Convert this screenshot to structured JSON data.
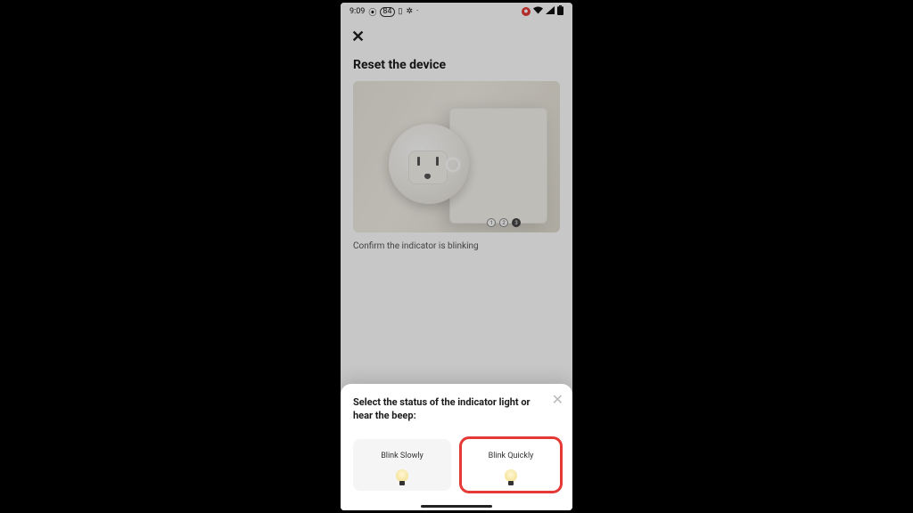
{
  "statusbar": {
    "time": "9:09",
    "batteryIcon": "84",
    "icons_left": [
      "camera",
      "vibrate",
      "bt"
    ],
    "icons_right": [
      "rec",
      "wifi",
      "signal",
      "battery"
    ]
  },
  "page": {
    "title": "Reset the device",
    "caption": "Confirm the indicator is blinking",
    "steps": {
      "total": 3,
      "current": 3
    }
  },
  "sheet": {
    "title": "Select the status of the indicator light or hear the beep:",
    "options": [
      {
        "label": "Blink Slowly",
        "highlighted": false
      },
      {
        "label": "Blink Quickly",
        "highlighted": true
      }
    ]
  }
}
